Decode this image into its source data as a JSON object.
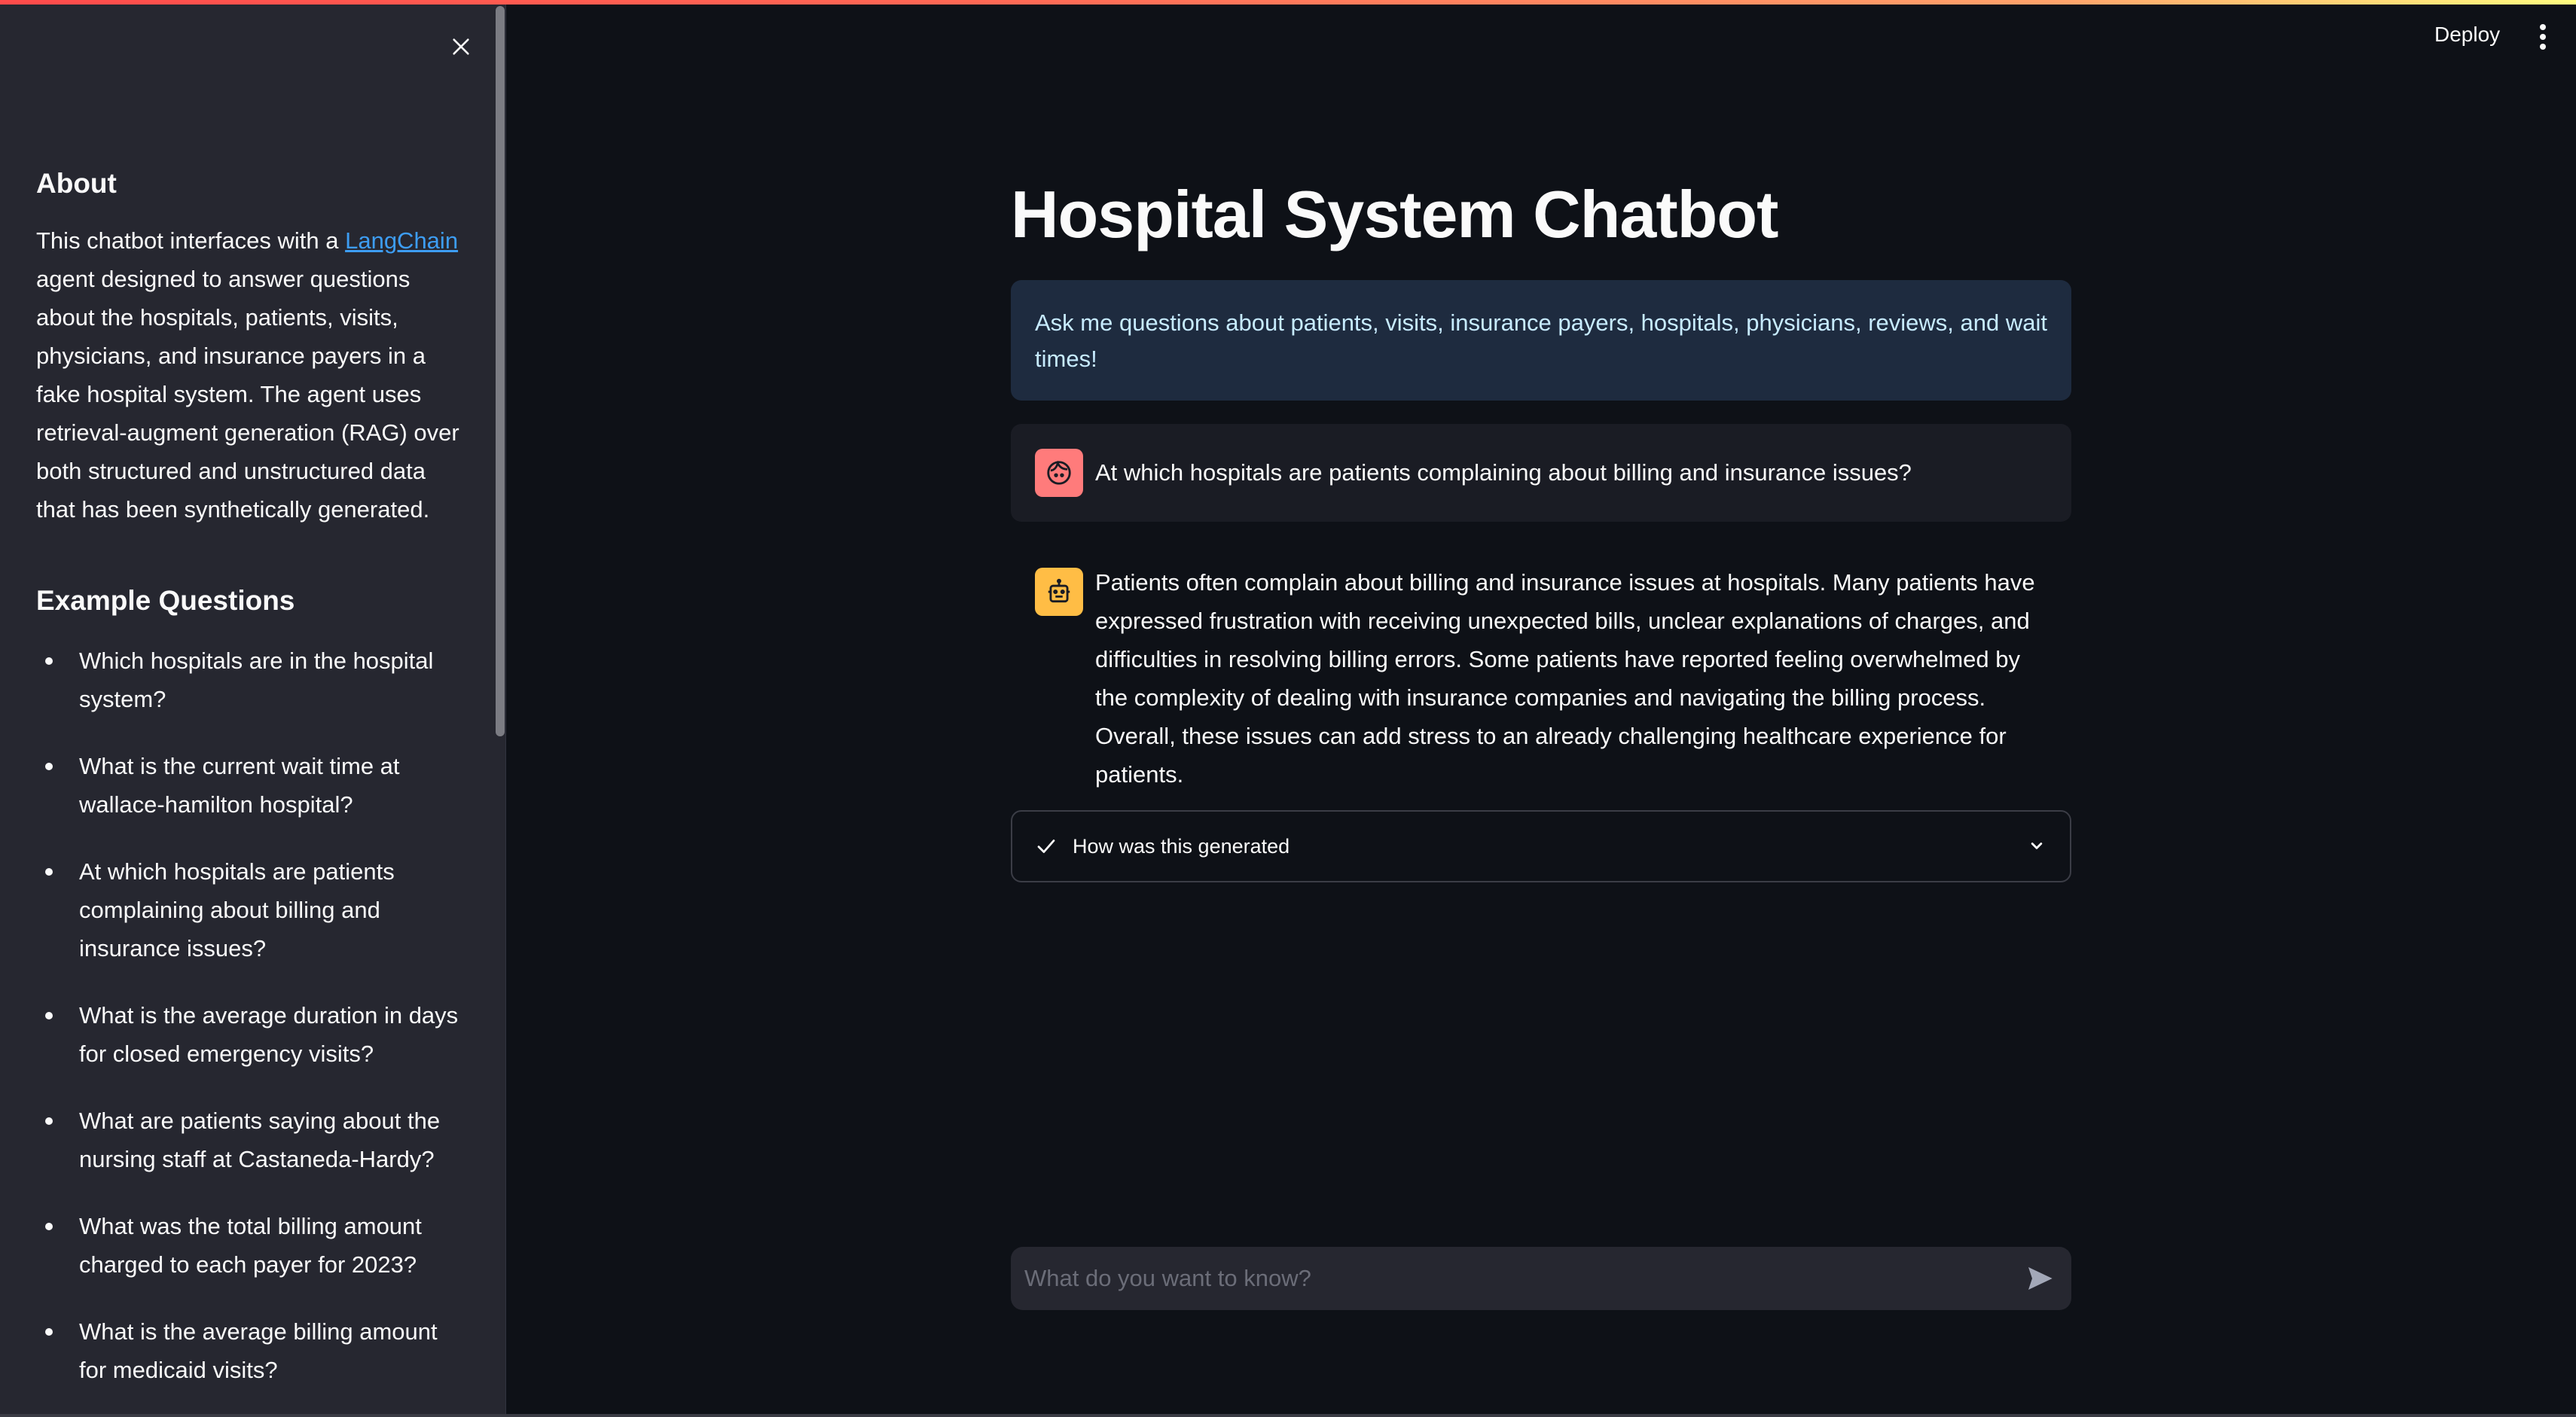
{
  "colors": {
    "background": "#0e1117",
    "sidebar": "#262730",
    "link": "#3d9df3",
    "info_bg": "#1e2b3f",
    "info_text": "#c7ebff",
    "user_avatar": "#ff7b7b",
    "bot_avatar": "#ffbd45"
  },
  "header": {
    "deploy_label": "Deploy",
    "menu_icon": "kebab-menu-icon"
  },
  "sidebar": {
    "close_icon": "close-icon",
    "about": {
      "heading": "About",
      "text_before_link": "This chatbot interfaces with a ",
      "link_text": "LangChain",
      "text_after_link": " agent designed to answer questions about the hospitals, patients, visits, physicians, and insurance payers in a fake hospital system. The agent uses retrieval-augment generation (RAG) over both structured and unstructured data that has been synthetically generated."
    },
    "examples": {
      "heading": "Example Questions",
      "items": [
        "Which hospitals are in the hospital system?",
        "What is the current wait time at wallace-hamilton hospital?",
        "At which hospitals are patients complaining about billing and insurance issues?",
        "What is the average duration in days for closed emergency visits?",
        "What are patients saying about the nursing staff at Castaneda-Hardy?",
        "What was the total billing amount charged to each payer for 2023?",
        "What is the average billing amount for medicaid visits?"
      ]
    }
  },
  "main": {
    "title": "Hospital System Chatbot",
    "info": "Ask me questions about patients, visits, insurance payers, hospitals, physicians, reviews, and wait times!",
    "messages": [
      {
        "role": "user",
        "avatar_icon": "user-face-icon",
        "text": "At which hospitals are patients complaining about billing and insurance issues?"
      },
      {
        "role": "assistant",
        "avatar_icon": "robot-icon",
        "text": "Patients often complain about billing and insurance issues at hospitals. Many patients have expressed frustration with receiving unexpected bills, unclear explanations of charges, and difficulties in resolving billing errors. Some patients have reported feeling overwhelmed by the complexity of dealing with insurance companies and navigating the billing process. Overall, these issues can add stress to an already challenging healthcare experience for patients."
      }
    ],
    "expander": {
      "label": "How was this generated",
      "status_icon": "check-icon",
      "toggle_icon": "chevron-down-icon"
    },
    "chat_input": {
      "placeholder": "What do you want to know?",
      "value": "",
      "send_icon": "send-icon"
    }
  }
}
